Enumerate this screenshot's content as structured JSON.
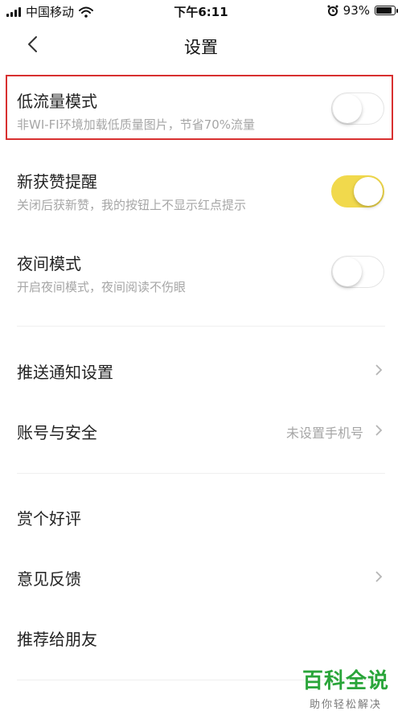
{
  "status_bar": {
    "carrier": "中国移动",
    "time": "下午6:11",
    "battery_percent": "93%",
    "battery_level": 0.93,
    "icons": [
      "signal-icon",
      "wifi-icon",
      "alarm-icon",
      "battery-icon"
    ]
  },
  "nav": {
    "title": "设置",
    "back_icon": "chevron-left-icon"
  },
  "settings": {
    "low_data": {
      "title": "低流量模式",
      "subtitle": "非WI-FI环境加载低质量图片，节省70%流量",
      "enabled": false
    },
    "new_like": {
      "title": "新获赞提醒",
      "subtitle": "关闭后获新赞，我的按钮上不显示红点提示",
      "enabled": true
    },
    "night_mode": {
      "title": "夜间模式",
      "subtitle": "开启夜间模式，夜间阅读不伤眼",
      "enabled": false
    },
    "push": {
      "title": "推送通知设置"
    },
    "account": {
      "title": "账号与安全",
      "value": "未设置手机号"
    },
    "rate": {
      "title": "赏个好评"
    },
    "feedback": {
      "title": "意见反馈"
    },
    "recommend": {
      "title": "推荐给朋友"
    }
  },
  "colors": {
    "toggle_on": "#f1d94c",
    "highlight_border": "#d83030",
    "watermark": "#2aa53a"
  },
  "watermark": {
    "main": "百科全说",
    "sub": "助你轻松解决"
  }
}
